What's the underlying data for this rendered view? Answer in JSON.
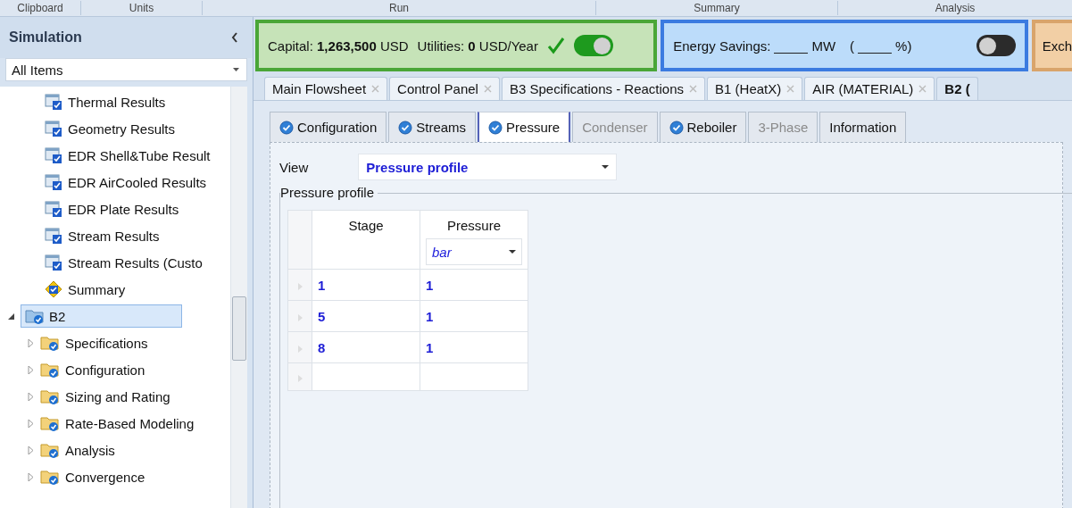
{
  "ribbon_groups": [
    "Clipboard",
    "Units",
    "Run",
    "Summary",
    "Analysis"
  ],
  "sidebar": {
    "title": "Simulation",
    "filter": "All Items",
    "partial_branch": [
      {
        "label": "Thermal Results",
        "kind": "results"
      },
      {
        "label": "Geometry Results",
        "kind": "results"
      },
      {
        "label": "EDR Shell&Tube Result",
        "kind": "results"
      },
      {
        "label": "EDR AirCooled Results",
        "kind": "results"
      },
      {
        "label": "EDR Plate Results",
        "kind": "results"
      },
      {
        "label": "Stream Results",
        "kind": "results"
      },
      {
        "label": "Stream Results (Custo",
        "kind": "results"
      },
      {
        "label": "Summary",
        "kind": "summary"
      }
    ],
    "tree": [
      {
        "label": "B2",
        "kind": "block",
        "expanded": true,
        "selected": true,
        "children": [
          {
            "label": "Specifications",
            "kind": "folder",
            "expanded": false,
            "selected": false
          },
          {
            "label": "Configuration",
            "kind": "folder",
            "expanded": false,
            "selected": false
          },
          {
            "label": "Sizing and Rating",
            "kind": "folder",
            "expanded": false,
            "selected": false
          },
          {
            "label": "Rate-Based Modeling",
            "kind": "folder",
            "expanded": false,
            "selected": false
          },
          {
            "label": "Analysis",
            "kind": "folder",
            "expanded": false,
            "selected": false
          },
          {
            "label": "Convergence",
            "kind": "folder",
            "expanded": false,
            "selected": false
          }
        ]
      }
    ]
  },
  "capital_panel": {
    "capital_label": "Capital:",
    "capital_value": "1,263,500",
    "capital_unit": "USD",
    "utilities_label": "Utilities:",
    "utilities_value": "0",
    "utilities_unit": "USD/Year",
    "ok": true,
    "on": true
  },
  "energy_panel": {
    "label": "Energy Savings:",
    "unit": "MW",
    "percent_open": "(",
    "percent_unit": "%)",
    "on": false
  },
  "exchanger_panel": {
    "label": "Exch"
  },
  "doc_tabs": [
    {
      "label": "Main Flowsheet",
      "selected": false
    },
    {
      "label": "Control Panel",
      "selected": false
    },
    {
      "label": "B3 Specifications - Reactions",
      "selected": false
    },
    {
      "label": "B1 (HeatX)",
      "selected": false
    },
    {
      "label": "AIR (MATERIAL)",
      "selected": false
    },
    {
      "label": "B2 (",
      "selected": true
    }
  ],
  "form_tabs": [
    {
      "label": "Configuration",
      "complete": true,
      "disabled": false,
      "selected": false
    },
    {
      "label": "Streams",
      "complete": true,
      "disabled": false,
      "selected": false
    },
    {
      "label": "Pressure",
      "complete": true,
      "disabled": false,
      "selected": true
    },
    {
      "label": "Condenser",
      "complete": false,
      "disabled": true,
      "selected": false
    },
    {
      "label": "Reboiler",
      "complete": true,
      "disabled": false,
      "selected": false
    },
    {
      "label": "3-Phase",
      "complete": false,
      "disabled": true,
      "selected": false
    },
    {
      "label": "Information",
      "complete": false,
      "disabled": false,
      "selected": false
    }
  ],
  "view": {
    "label": "View",
    "value": "Pressure profile"
  },
  "profile": {
    "title": "Pressure profile",
    "columns": [
      {
        "label": "Stage"
      },
      {
        "label": "Pressure",
        "unit": "bar"
      }
    ],
    "rows": [
      [
        "1",
        "1"
      ],
      [
        "5",
        "1"
      ],
      [
        "8",
        "1"
      ]
    ]
  }
}
